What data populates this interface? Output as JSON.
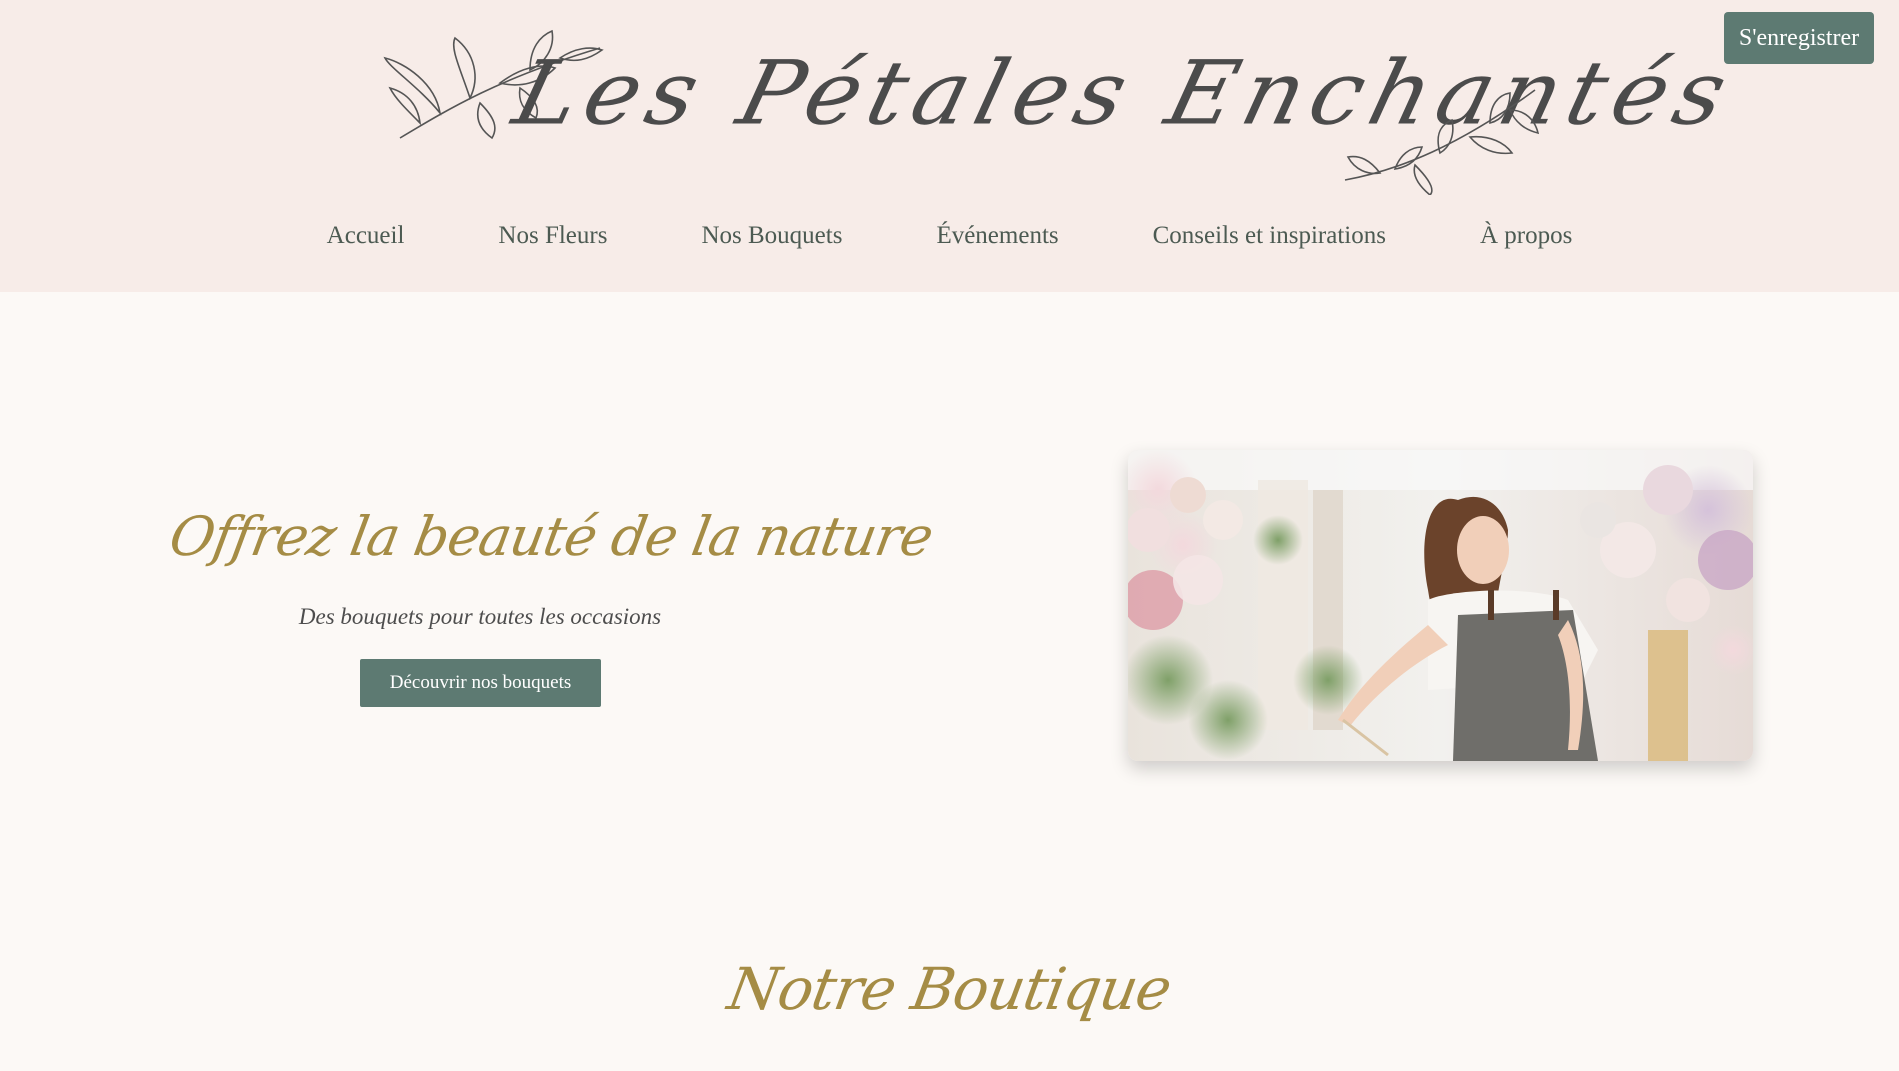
{
  "brand": {
    "logo_text": "Les Pétales Enchantés"
  },
  "header": {
    "register_label": "S'enregistrer"
  },
  "nav": {
    "items": [
      {
        "label": "Accueil"
      },
      {
        "label": "Nos Fleurs"
      },
      {
        "label": "Nos Bouquets"
      },
      {
        "label": "Événements"
      },
      {
        "label": "Conseils et inspirations"
      },
      {
        "label": "À propos"
      }
    ]
  },
  "hero": {
    "title": "Offrez la beauté de la nature",
    "subtitle": "Des bouquets pour toutes les occasions",
    "cta_label": "Découvrir nos bouquets",
    "image_alt": "florist-arranging-flowers-photo"
  },
  "shop": {
    "title": "Notre Boutique"
  },
  "colors": {
    "header_bg": "#f7ece8",
    "page_bg": "#fcf9f6",
    "button": "#5d7a72",
    "gold": "#a58c45",
    "nav_text": "#4c5a52"
  }
}
